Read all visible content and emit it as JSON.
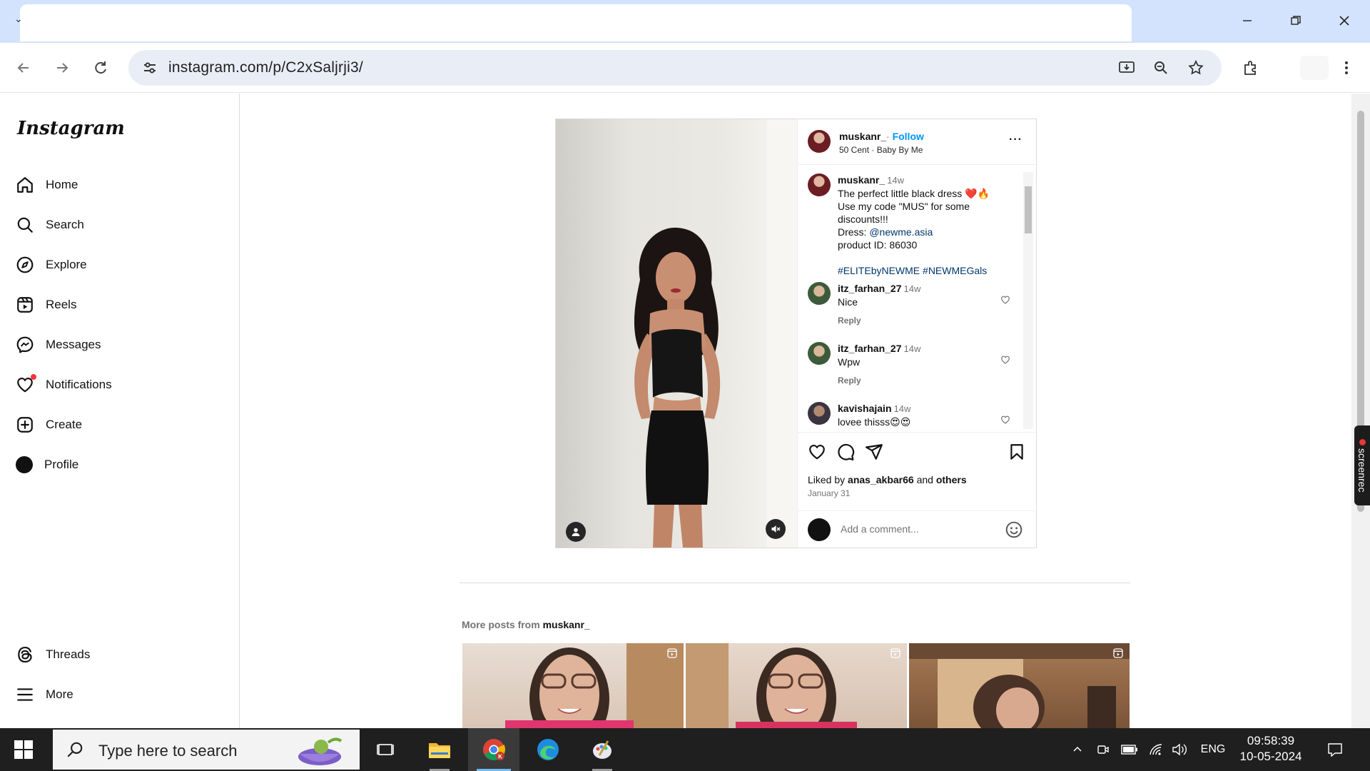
{
  "browser": {
    "url": "instagram.com/p/C2xSaljrji3/"
  },
  "sidebar": {
    "logo": "Instagram",
    "items": [
      {
        "label": "Home",
        "icon": "home-icon"
      },
      {
        "label": "Search",
        "icon": "search-icon"
      },
      {
        "label": "Explore",
        "icon": "compass-icon"
      },
      {
        "label": "Reels",
        "icon": "reels-icon"
      },
      {
        "label": "Messages",
        "icon": "messenger-icon"
      },
      {
        "label": "Notifications",
        "icon": "heart-icon"
      },
      {
        "label": "Create",
        "icon": "plus-square-icon"
      },
      {
        "label": "Profile",
        "icon": "avatar"
      }
    ],
    "bottom": [
      {
        "label": "Threads",
        "icon": "threads-icon"
      },
      {
        "label": "More",
        "icon": "menu-icon"
      }
    ]
  },
  "post": {
    "author": "muskanr_",
    "follow_label": "Follow",
    "separator": "·",
    "audio": "50 Cent · Baby By Me",
    "caption": {
      "user": "muskanr_",
      "time": "14w",
      "lines": [
        "The perfect little black dress ❤️🔥",
        "Use my code \"MUS\" for some discounts!!!",
        "Dress: ",
        "product ID: 86030",
        "#ELITEbyNEWME #NEWMEGals"
      ],
      "mention": "@newme.asia"
    },
    "comments": [
      {
        "user": "itz_farhan_27",
        "time": "14w",
        "text": "Nice",
        "reply": "Reply"
      },
      {
        "user": "itz_farhan_27",
        "time": "14w",
        "text": "Wpw",
        "reply": "Reply"
      },
      {
        "user": "kavishajain",
        "time": "14w",
        "text": "lovee thisss😍😍"
      }
    ],
    "liked_by_prefix": "Liked by",
    "liked_by_user": "anas_akbar66",
    "liked_by_and": "and",
    "liked_by_others": "others",
    "date": "January 31",
    "comment_placeholder": "Add a comment..."
  },
  "more_posts": {
    "prefix": "More posts from",
    "user": "muskanr_"
  },
  "taskbar": {
    "search_placeholder": "Type here to search",
    "language": "ENG",
    "time": "09:58:39",
    "date": "10-05-2024"
  },
  "overlay": {
    "screenrec_label": "screenrec"
  }
}
